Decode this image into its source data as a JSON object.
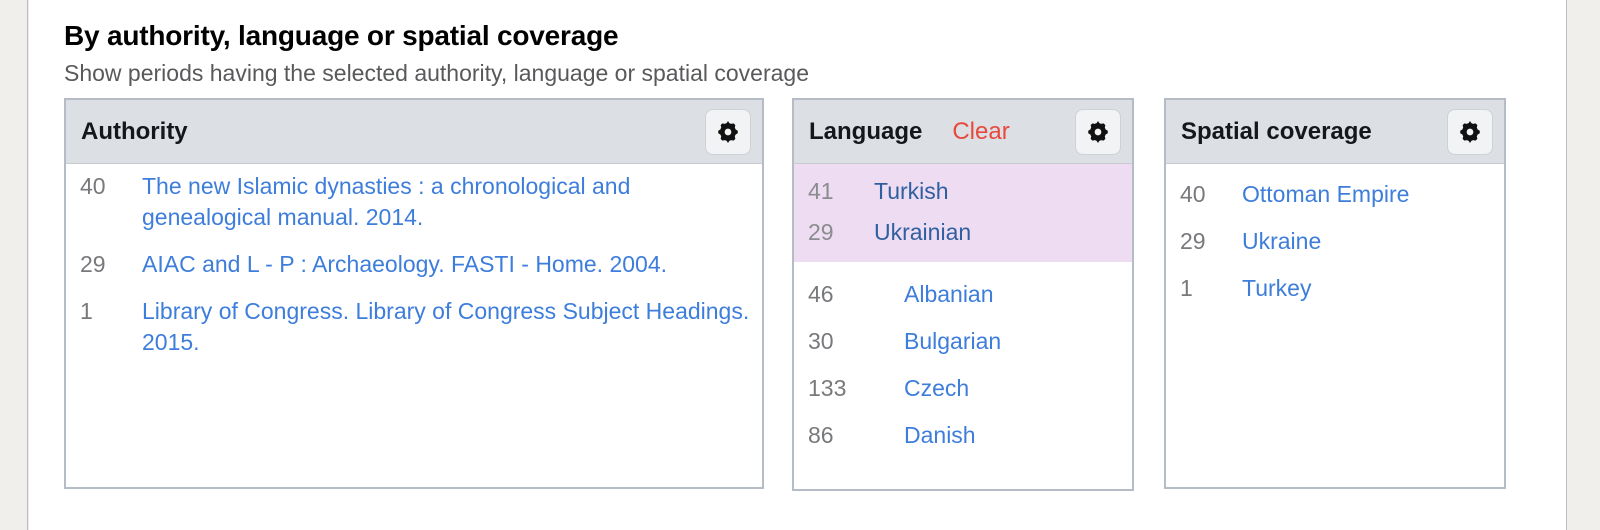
{
  "section": {
    "title": "By authority, language or spatial coverage",
    "subtitle": "Show periods having the selected authority, language or spatial coverage"
  },
  "colors": {
    "link": "#3d7ddb",
    "link_selected": "#2f5f9e",
    "clear": "#e8493c",
    "selected_row_background": "#eedcf3",
    "panel_header_background": "#dcdfe4",
    "panel_border": "#b6bcc6",
    "count_text": "#78797c",
    "page_background": "#f1efeb"
  },
  "panels": {
    "authority": {
      "title": "Authority",
      "gear_icon": "gear-icon",
      "items": [
        {
          "count": "40",
          "label": "The new Islamic dynasties : a chronological and genealogical manual. 2014."
        },
        {
          "count": "29",
          "label": "AIAC and L - P : Archaeology. FASTI - Home. 2004."
        },
        {
          "count": "1",
          "label": "Library of Congress. Library of Congress Subject Headings. 2015."
        }
      ]
    },
    "language": {
      "title": "Language",
      "clear_label": "Clear",
      "gear_icon": "gear-icon",
      "selected_items": [
        {
          "count": "41",
          "label": "Turkish"
        },
        {
          "count": "29",
          "label": "Ukrainian"
        }
      ],
      "items": [
        {
          "count": "46",
          "label": "Albanian"
        },
        {
          "count": "30",
          "label": "Bulgarian"
        },
        {
          "count": "133",
          "label": "Czech"
        },
        {
          "count": "86",
          "label": "Danish"
        }
      ]
    },
    "spatial": {
      "title": "Spatial coverage",
      "gear_icon": "gear-icon",
      "items": [
        {
          "count": "40",
          "label": "Ottoman Empire"
        },
        {
          "count": "29",
          "label": "Ukraine"
        },
        {
          "count": "1",
          "label": "Turkey"
        }
      ]
    }
  }
}
